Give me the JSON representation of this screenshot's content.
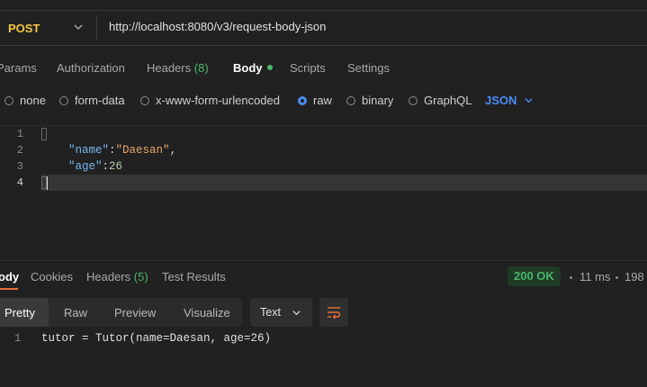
{
  "request": {
    "method": "POST",
    "url": "http://localhost:8080/v3/request-body-json"
  },
  "request_tabs": [
    {
      "label": "Params"
    },
    {
      "label": "Authorization"
    },
    {
      "label": "Headers",
      "count": "(8)"
    },
    {
      "label": "Body"
    },
    {
      "label": "Scripts"
    },
    {
      "label": "Settings"
    }
  ],
  "body_types": {
    "none": "none",
    "form_data": "form-data",
    "urlencoded": "x-www-form-urlencoded",
    "raw": "raw",
    "binary": "binary",
    "graphql": "GraphQL",
    "format": "JSON"
  },
  "editor": {
    "line_numbers": [
      "1",
      "2",
      "3",
      "4"
    ],
    "line2": {
      "key": "\"name\"",
      "colon": ":",
      "value": "\"Daesan\"",
      "tail": ","
    },
    "line3": {
      "key": "\"age\"",
      "colon": ":",
      "value": "26"
    }
  },
  "response_tabs": [
    {
      "label": "ody"
    },
    {
      "label": "Cookies"
    },
    {
      "label": "Headers",
      "count": "(5)"
    },
    {
      "label": "Test Results"
    }
  ],
  "response_meta": {
    "status": "200 OK",
    "time": "11 ms",
    "size": "198"
  },
  "view_modes": [
    "Pretty",
    "Raw",
    "Preview",
    "Visualize"
  ],
  "view_format": "Text",
  "output": {
    "line_number": "1",
    "text": "tutor = Tutor(name=Daesan, age=26)"
  },
  "colors": {
    "accent_blue": "#4a8df7",
    "method_yellow": "#f5c542",
    "status_green": "#49b86b",
    "wrap_icon_orange": "#e8723a"
  }
}
